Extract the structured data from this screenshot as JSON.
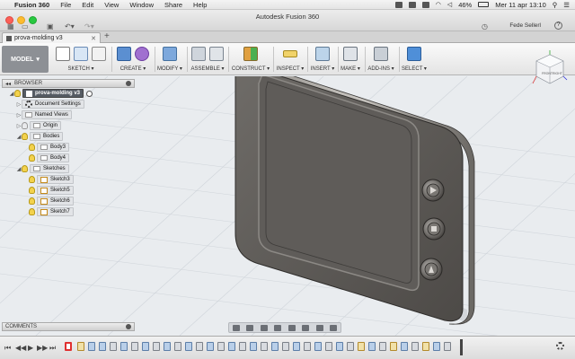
{
  "menubar": {
    "app_name": "Fusion 360",
    "items": [
      "File",
      "Edit",
      "View",
      "Window",
      "Share",
      "Help"
    ],
    "battery": "46%",
    "datetime": "Mer 11 apr  13:10"
  },
  "titlebar": {
    "title": "Autodesk Fusion 360",
    "user": "Fede Sellerl"
  },
  "tabs": [
    {
      "label": "prova-molding v3"
    }
  ],
  "toolbar": {
    "workspace": "MODEL",
    "groups": [
      "SKETCH",
      "CREATE",
      "MODIFY",
      "ASSEMBLE",
      "CONSTRUCT",
      "INSPECT",
      "INSERT",
      "MAKE",
      "ADD-INS",
      "SELECT"
    ]
  },
  "browser": {
    "header": "BROWSER",
    "root": "prova-molding v3",
    "doc_settings": "Document Settings",
    "named_views": "Named Views",
    "origin": "Origin",
    "bodies": "Bodies",
    "body_items": [
      "Body3",
      "Body4"
    ],
    "sketches": "Sketches",
    "sketch_items": [
      "Sketch3",
      "Sketch5",
      "Sketch6",
      "Sketch7"
    ]
  },
  "comments": {
    "header": "COMMENTS"
  },
  "viewcube": {
    "faces": [
      "FRONT",
      "RIGHT"
    ]
  },
  "colors": {
    "accent": "#4f8fd8",
    "folder_dark": "#555b63",
    "viewport_bg": "#e9ecef"
  }
}
